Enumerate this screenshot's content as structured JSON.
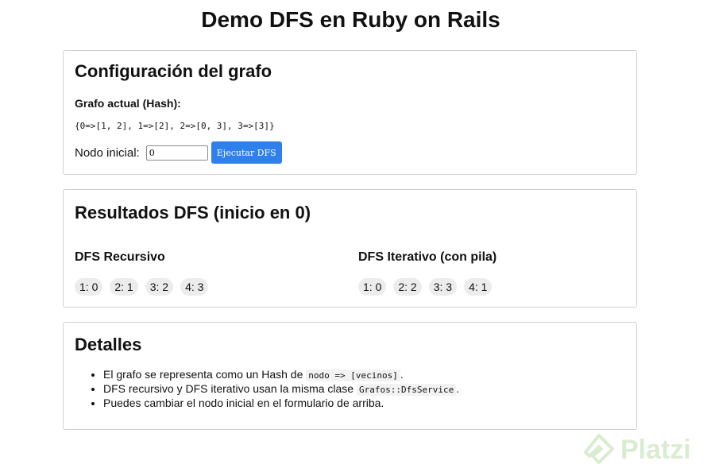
{
  "page": {
    "title": "Demo DFS en Ruby on Rails"
  },
  "config": {
    "heading": "Configuración del grafo",
    "graph_label": "Grafo actual (Hash):",
    "graph_value": "{0=>[1, 2], 1=>[2], 2=>[0, 3], 3=>[3]}",
    "start_label": "Nodo inicial:",
    "start_value": "0",
    "run_button": "Ejecutar DFS"
  },
  "results": {
    "heading": "Resultados DFS (inicio en 0)",
    "recursive": {
      "heading": "DFS Recursivo",
      "items": [
        "1: 0",
        "2: 1",
        "3: 2",
        "4: 3"
      ]
    },
    "iterative": {
      "heading": "DFS Iterativo (con pila)",
      "items": [
        "1: 0",
        "2: 2",
        "3: 3",
        "4: 1"
      ]
    }
  },
  "details": {
    "heading": "Detalles",
    "items": [
      {
        "before": "El grafo se representa como un Hash de ",
        "code": "nodo => [vecinos]",
        "after": "."
      },
      {
        "before": "DFS recursivo y DFS iterativo usan la misma clase ",
        "code": "Grafos::DfsService",
        "after": "."
      },
      {
        "before": "Puedes cambiar el nodo inicial en el formulario de arriba.",
        "code": "",
        "after": ""
      }
    ]
  },
  "watermark": {
    "text": "Platzi"
  },
  "colors": {
    "button": "#2f80ed",
    "chip": "#ececec",
    "border": "#d0d0d0",
    "watermark": "#98c97a"
  }
}
